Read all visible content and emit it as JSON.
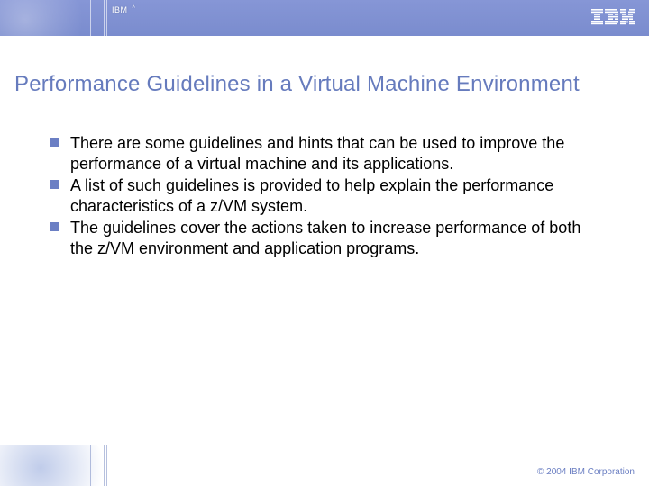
{
  "header": {
    "badge_prefix": "IBM",
    "badge_suffix": "^",
    "logo_alt": "IBM"
  },
  "title": "Performance Guidelines in a Virtual Machine Environment",
  "bullets": [
    "There are some guidelines and hints that can be used to improve the performance of a virtual machine and its applications.",
    "A list of such guidelines is provided to help explain the performance characteristics of a z/VM system.",
    "The guidelines cover the actions taken to increase performance of both the z/VM environment and application programs."
  ],
  "footer": {
    "copyright": "© 2004 IBM Corporation"
  }
}
